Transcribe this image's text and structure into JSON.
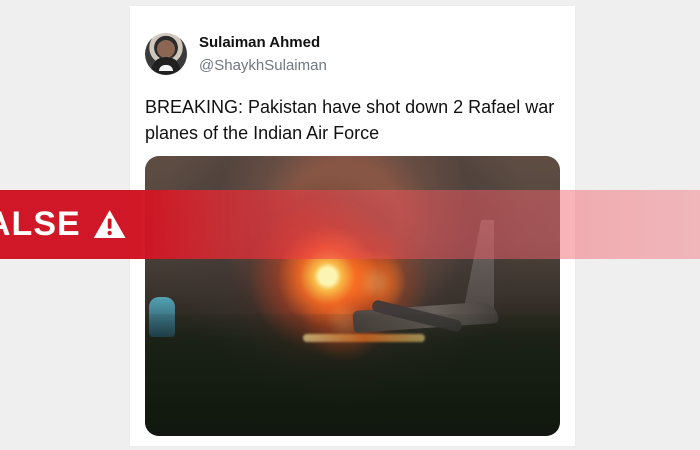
{
  "tweet": {
    "author_name": "Sulaiman Ahmed",
    "author_handle": "@ShaykhSulaiman",
    "text": "BREAKING: Pakistan have shot down 2 Rafael war planes of the Indian Air Force"
  },
  "overlay": {
    "label": "ALSE",
    "icon": "warning-icon",
    "accent": "#d01323"
  }
}
